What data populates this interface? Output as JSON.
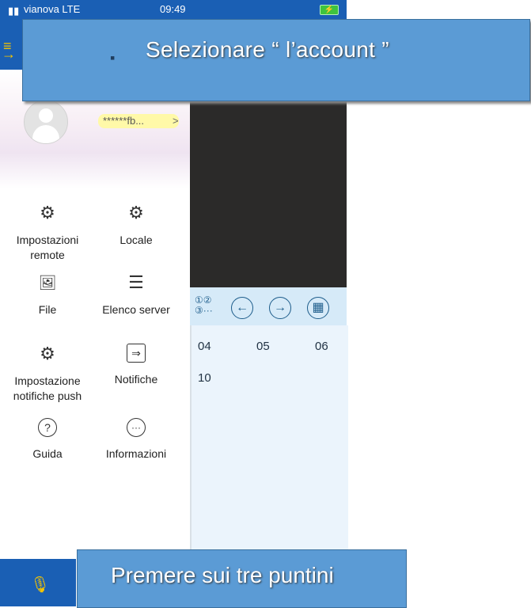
{
  "status_bar": {
    "carrier": "vianova  LTE",
    "time": "09:49",
    "battery": "⚡"
  },
  "profile": {
    "account": "******fb...",
    "chevron": ">"
  },
  "menu": {
    "items": [
      {
        "label": "Impostazioni remote",
        "icon": "remote-settings-icon",
        "glyph": "⚙"
      },
      {
        "label": "Locale",
        "icon": "local-settings-icon",
        "glyph": "⚙"
      },
      {
        "label": "File",
        "icon": "image-file-icon",
        "glyph": "🖼"
      },
      {
        "label": "Elenco server",
        "icon": "server-list-icon",
        "glyph": "☰"
      },
      {
        "label": "Impostazione notifiche push",
        "icon": "push-settings-icon",
        "glyph": "⚙"
      },
      {
        "label": "Notifiche",
        "icon": "notifications-icon",
        "glyph": "⇒"
      },
      {
        "label": "Guida",
        "icon": "help-icon",
        "glyph": "?"
      },
      {
        "label": "Informazioni",
        "icon": "info-more-icon",
        "glyph": "···"
      }
    ]
  },
  "toolbar": {
    "split_top": "①②",
    "split_bottom": "③···",
    "prev": "←",
    "next": "→",
    "grid": "▦"
  },
  "channels": [
    "04",
    "05",
    "06",
    "10"
  ],
  "annotations": {
    "top": "Selezionare “ l’account ”",
    "top_bullet": "▪",
    "bottom": "Premere sui tre puntini"
  },
  "colors": {
    "brand_blue": "#1a5fb4",
    "callout_blue": "#5b9bd5",
    "highlight": "#fff9a8"
  }
}
